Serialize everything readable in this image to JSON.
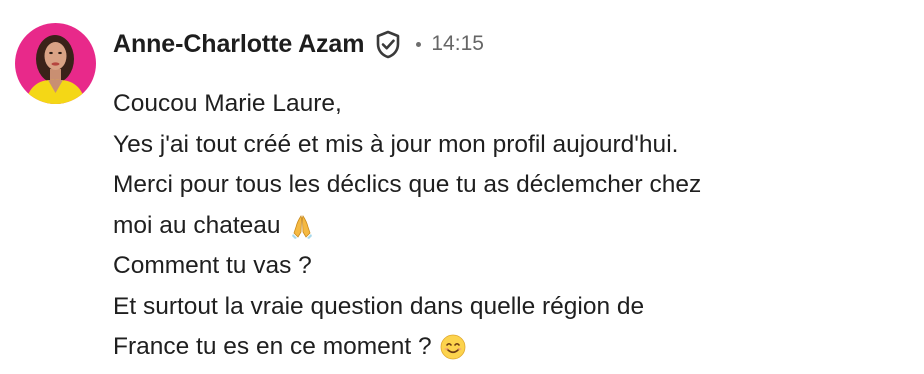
{
  "message": {
    "sender_name": "Anne-Charlotte Azam",
    "timestamp": "14:15",
    "lines": [
      "Coucou Marie Laure,",
      "Yes j'ai tout créé et mis à jour mon profil aujourd'hui.",
      "Merci pour tous les déclics que tu as déclemcher chez",
      "moi au chateau",
      "Comment tu vas ?",
      "Et surtout la vraie question dans quelle région de",
      "France tu es en ce moment ?"
    ],
    "emojis": {
      "line_4": "praying-hands",
      "line_7": "smiling-face"
    },
    "icons": {
      "verified": "shield-check-icon"
    },
    "colors": {
      "avatar_background": "#e8298a",
      "avatar_outfit": "#f4d716",
      "timestamp": "#666666",
      "text": "#1f1f1f"
    }
  }
}
